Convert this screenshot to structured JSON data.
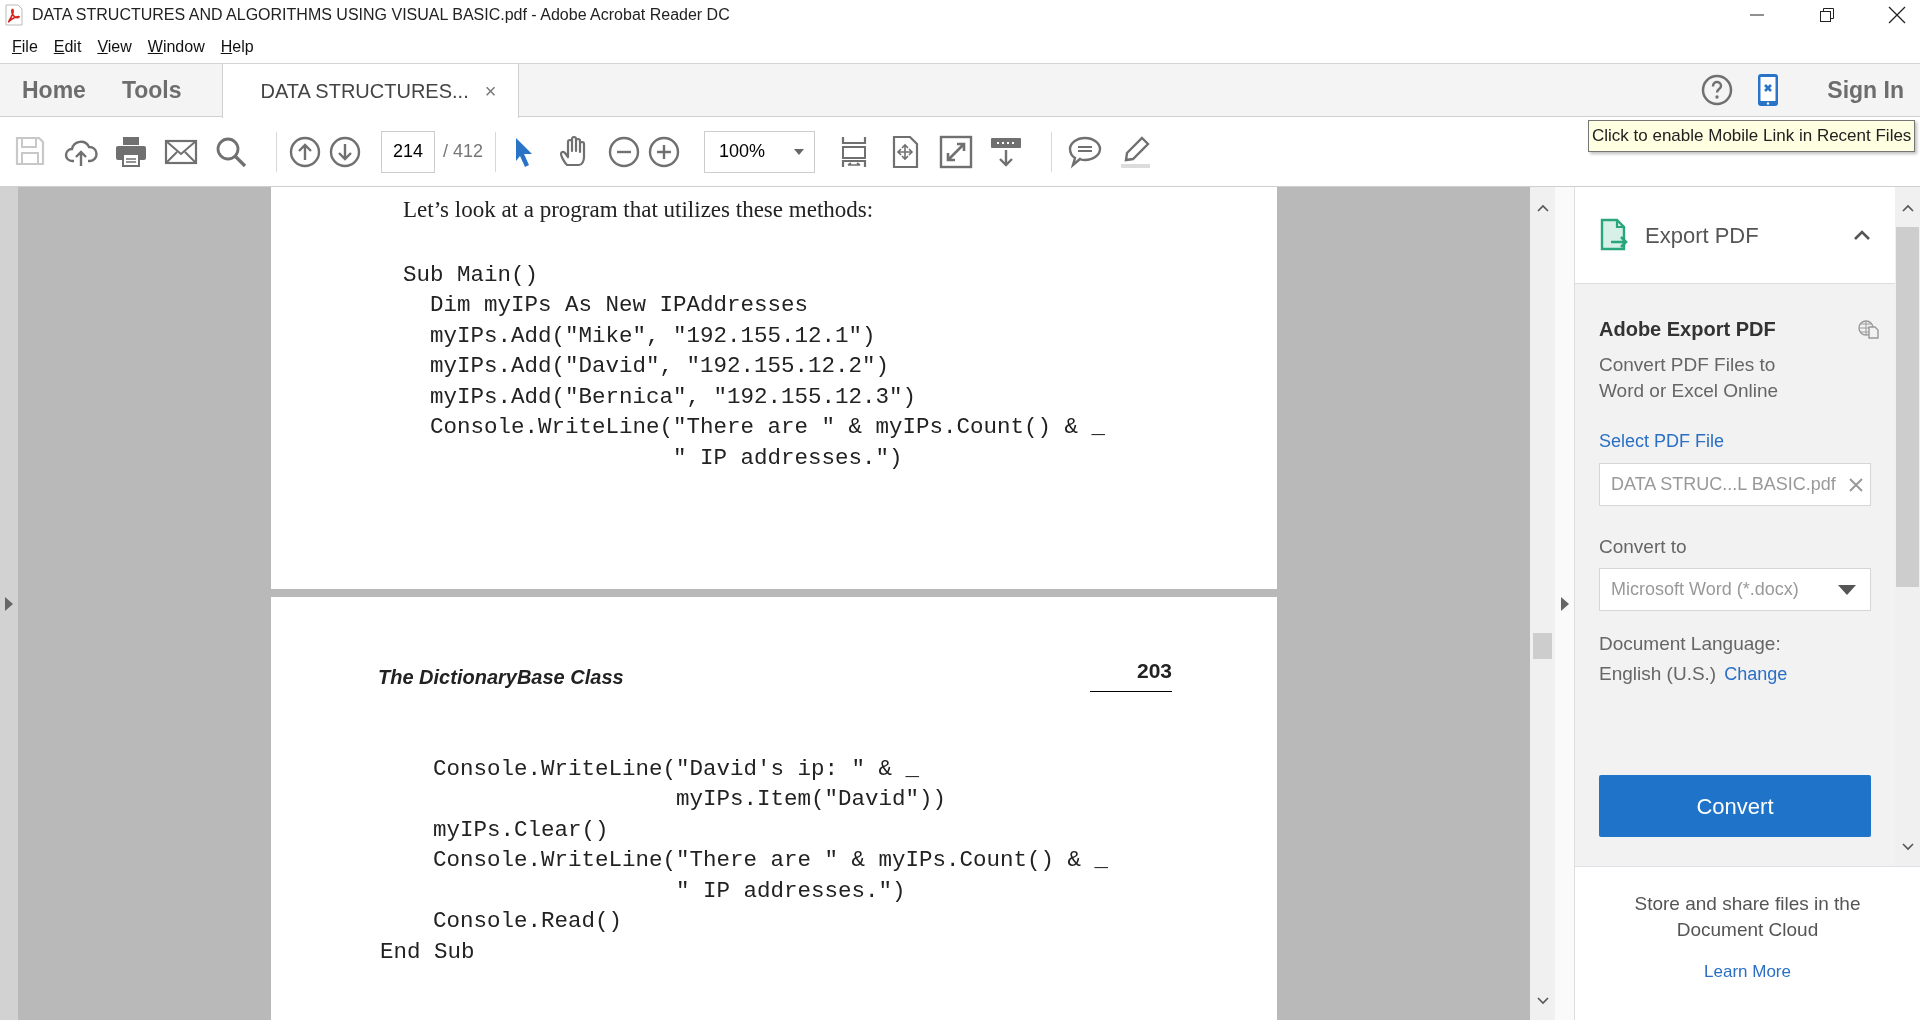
{
  "window": {
    "title": "DATA STRUCTURES AND ALGORITHMS USING VISUAL BASIC.pdf - Adobe Acrobat Reader DC"
  },
  "menu": [
    "File",
    "Edit",
    "View",
    "Window",
    "Help"
  ],
  "tabs": [
    {
      "label": "Home",
      "selected": false
    },
    {
      "label": "Tools",
      "selected": false
    },
    {
      "label": "DATA STRUCTURES...",
      "selected": true,
      "close": "×"
    }
  ],
  "account": {
    "sign_in": "Sign In"
  },
  "tooltip": "Click to enable Mobile Link in Recent Files",
  "toolbar": {
    "file_tools": [
      {
        "disabled": true
      },
      {
        "disabled": false
      },
      {
        "disabled": false
      },
      {
        "disabled": false
      },
      {
        "disabled": false
      }
    ],
    "page": {
      "value": "214",
      "total": "/ 412"
    },
    "pointer_tools": [
      {
        "selected": true
      },
      {
        "selected": false
      }
    ],
    "zoom": {
      "value": "100%"
    }
  },
  "document": {
    "pages": [
      {
        "paragraph": "Let’s look at a program that utilizes these methods:",
        "code": [
          "Sub Main()",
          "  Dim myIPs As New IPAddresses",
          "  myIPs.Add(\"Mike\", \"192.155.12.1\")",
          "  myIPs.Add(\"David\", \"192.155.12.2\")",
          "  myIPs.Add(\"Bernica\", \"192.155.12.3\")",
          "  Console.WriteLine(\"There are \" & myIPs.Count() & _",
          "                    \" IP addresses.\")"
        ]
      },
      {
        "running_head": "The DictionaryBase Class",
        "page_number": "203",
        "code": [
          "  Console.WriteLine(\"David's ip: \" & _",
          "                    myIPs.Item(\"David\"))",
          "  myIPs.Clear()",
          "  Console.WriteLine(\"There are \" & myIPs.Count() & _",
          "                    \" IP addresses.\")",
          "  Console.Read()",
          "End Sub"
        ]
      }
    ]
  },
  "export_panel": {
    "title": "Export PDF",
    "expanded": true,
    "heading": "Adobe Export PDF",
    "description": "Convert PDF Files to Word or Excel Online",
    "select_link": "Select PDF File",
    "file": {
      "value": "DATA STRUC...L BASIC.pdf"
    },
    "convert_to_label": "Convert to",
    "format": {
      "value": "Microsoft Word (*.docx)"
    },
    "language_label": "Document Language:",
    "language": "English (U.S.)",
    "change_link": "Change",
    "button": "Convert",
    "cloud_note": "Store and share files in the Document Cloud",
    "learn_more": "Learn More"
  }
}
